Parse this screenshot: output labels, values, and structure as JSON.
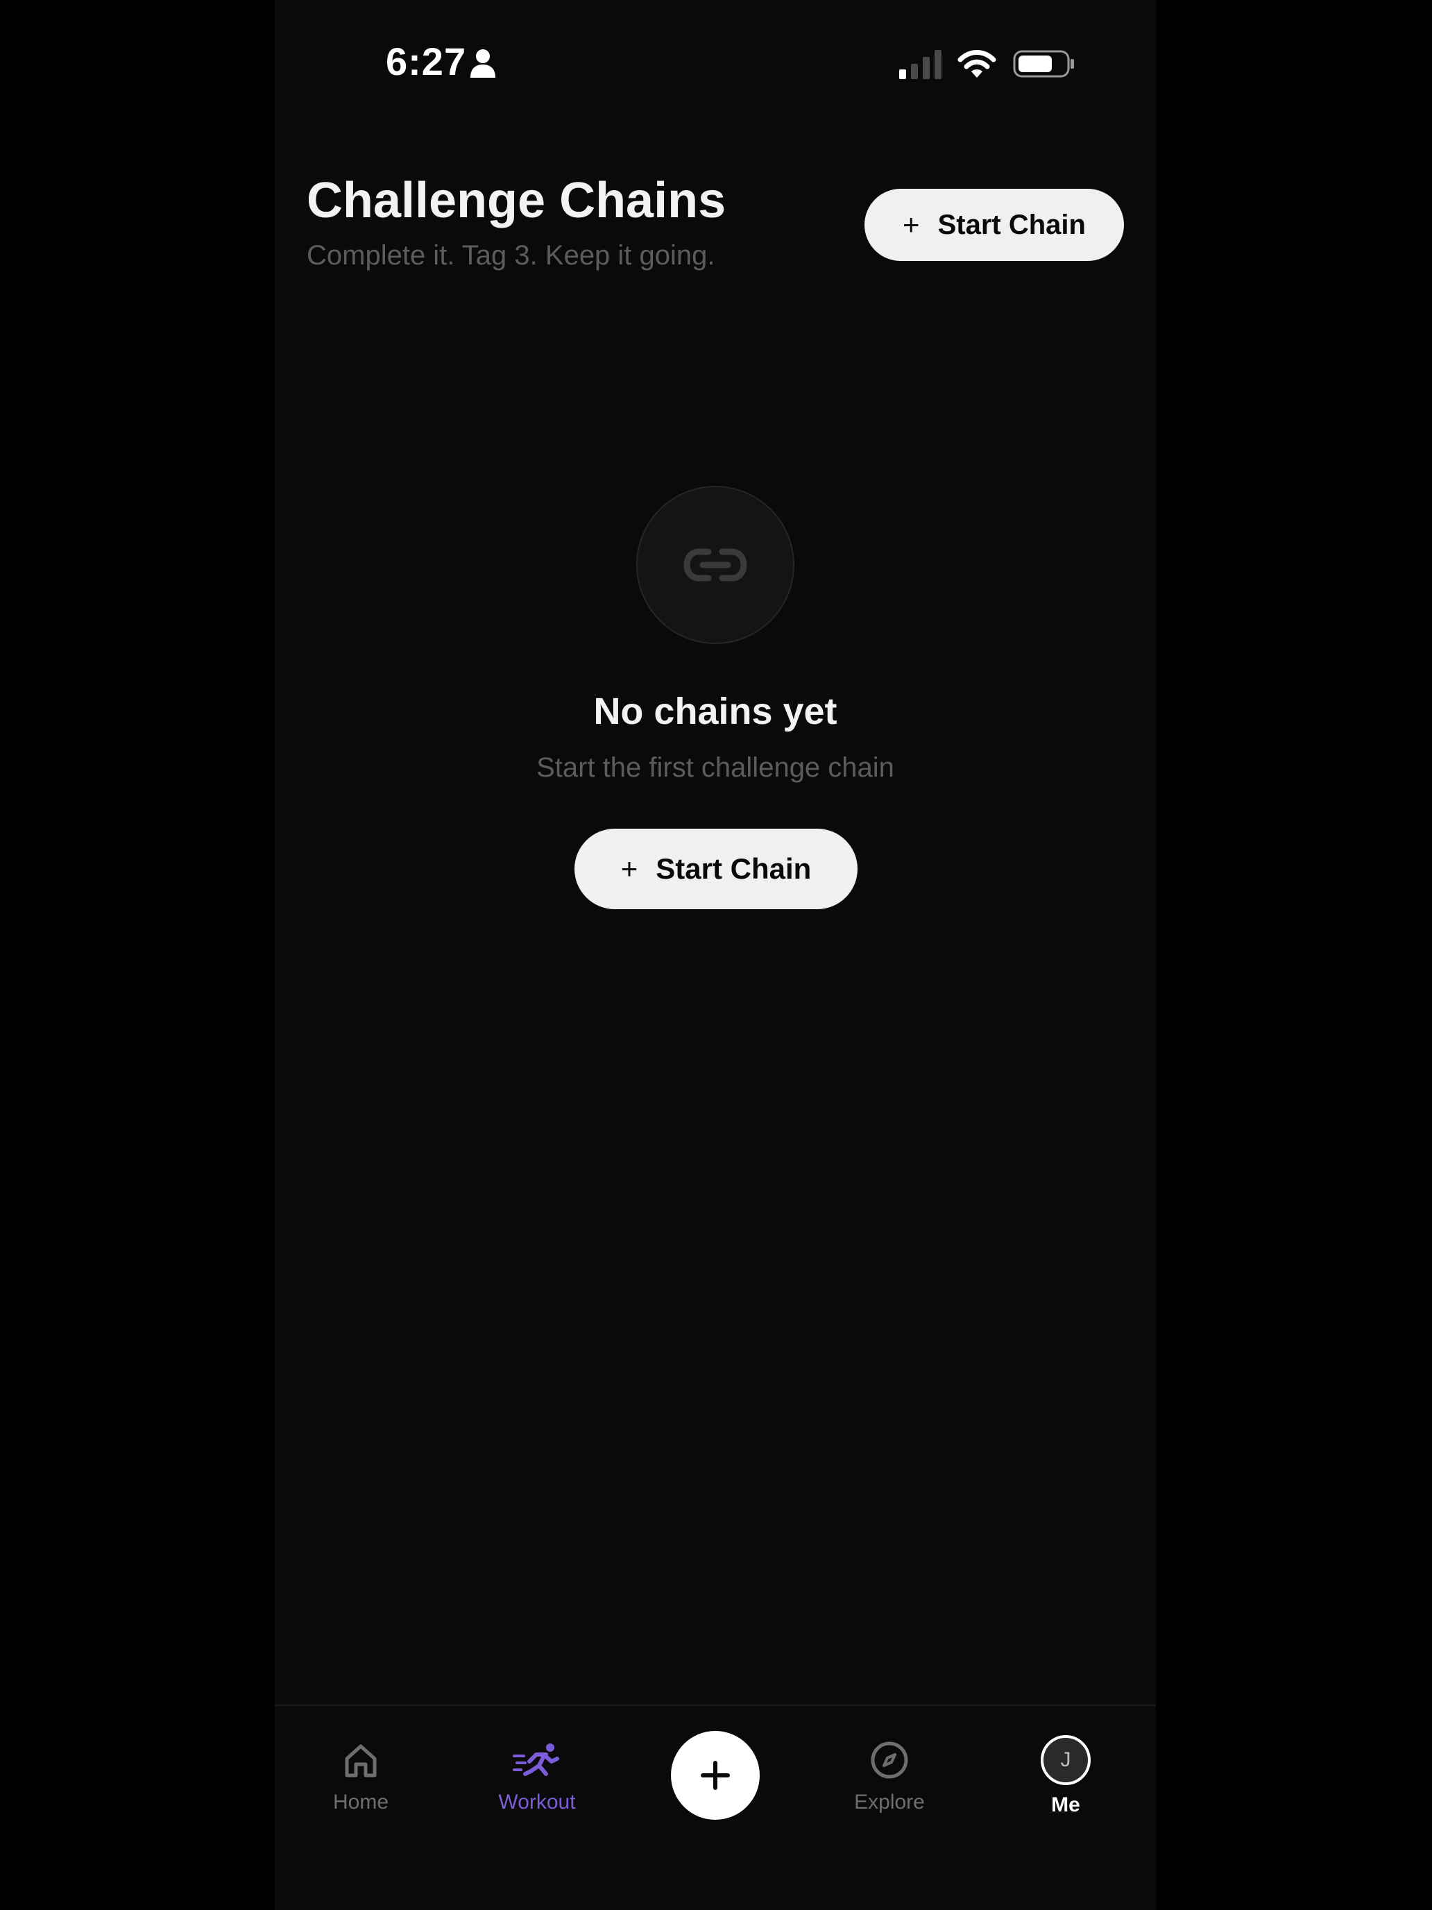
{
  "status_bar": {
    "time": "6:27"
  },
  "header": {
    "title": "Challenge Chains",
    "subtitle": "Complete it. Tag 3. Keep it going.",
    "start_button_label": "Start Chain"
  },
  "empty_state": {
    "icon": "link-icon",
    "title": "No chains yet",
    "subtitle": "Start the first challenge chain",
    "button_label": "Start Chain"
  },
  "bottom_nav": {
    "items": [
      {
        "label": "Home",
        "icon": "home-icon",
        "active": false
      },
      {
        "label": "Workout",
        "icon": "running-icon",
        "active": true
      },
      {
        "label": "Explore",
        "icon": "compass-icon",
        "active": false
      },
      {
        "label": "Me",
        "icon": "avatar",
        "active": false
      }
    ],
    "avatar_initial": "J"
  },
  "colors": {
    "background": "#0a0a0a",
    "accent": "#7c5cd8",
    "button_bg": "#f0f0f0",
    "muted_text": "#5c5c5c"
  }
}
